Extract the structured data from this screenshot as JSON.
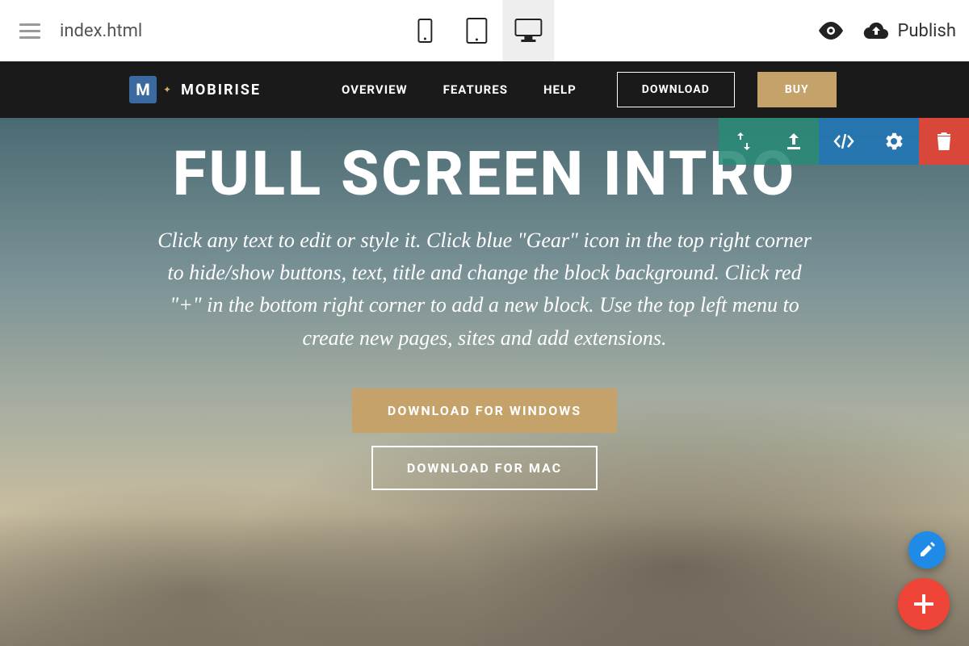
{
  "toolbar": {
    "filename": "index.html",
    "publish_label": "Publish"
  },
  "nav": {
    "brand": "MOBIRISE",
    "links": [
      "OVERVIEW",
      "FEATURES",
      "HELP"
    ],
    "download_label": "DOWNLOAD",
    "buy_label": "BUY"
  },
  "hero": {
    "title": "FULL SCREEN INTRO",
    "description": "Click any text to edit or style it. Click blue \"Gear\" icon in the top right corner to hide/show buttons, text, title and change the block background. Click red \"+\" in the bottom right corner to add a new block. Use the top left menu to create new pages, sites and add extensions.",
    "btn_windows": "DOWNLOAD FOR WINDOWS",
    "btn_mac": "DOWNLOAD FOR MAC"
  },
  "colors": {
    "accent_tan": "#c4a26a",
    "fab_blue": "#1f8be6",
    "fab_red": "#ef4538"
  }
}
